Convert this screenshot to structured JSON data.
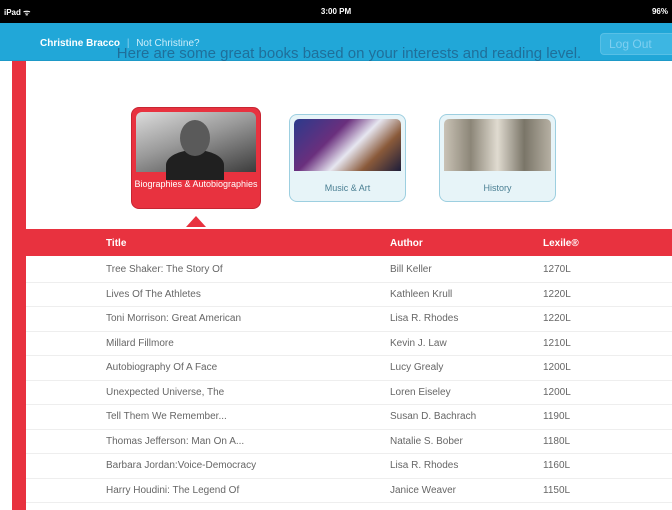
{
  "status_bar": {
    "left": "iPad ᯤ",
    "time": "3:00 PM",
    "battery": "96%"
  },
  "header": {
    "user_name": "Christine Bracco",
    "separator": "|",
    "not_user": "Not Christine?",
    "logout_label": "Log Out"
  },
  "headline": "Here are some great books based on your interests and reading level.",
  "categories": [
    {
      "label": "Biographies & Autobiographies",
      "selected": true
    },
    {
      "label": "Music & Art",
      "selected": false
    },
    {
      "label": "History",
      "selected": false
    }
  ],
  "table": {
    "columns": [
      "Title",
      "Author",
      "Lexile®"
    ],
    "rows": [
      [
        "Tree Shaker: The Story Of",
        "Bill Keller",
        "1270L"
      ],
      [
        "Lives Of The Athletes",
        "Kathleen Krull",
        "1220L"
      ],
      [
        "Toni Morrison: Great American",
        "Lisa R. Rhodes",
        "1220L"
      ],
      [
        "Millard Fillmore",
        "Kevin J. Law",
        "1210L"
      ],
      [
        "Autobiography Of A Face",
        "Lucy Grealy",
        "1200L"
      ],
      [
        "Unexpected Universe, The",
        "Loren Eiseley",
        "1200L"
      ],
      [
        "Tell Them We Remember...",
        "Susan D. Bachrach",
        "1190L"
      ],
      [
        "Thomas Jefferson: Man On A...",
        "Natalie S. Bober",
        "1180L"
      ],
      [
        "Barbara Jordan:Voice-Democracy",
        "Lisa R. Rhodes",
        "1160L"
      ],
      [
        "Harry Houdini: The Legend Of",
        "Janice Weaver",
        "1150L"
      ]
    ]
  },
  "colors": {
    "accent_red": "#e8323f",
    "header_blue": "#21a7d8",
    "headline_blue": "#1f6f9a"
  }
}
